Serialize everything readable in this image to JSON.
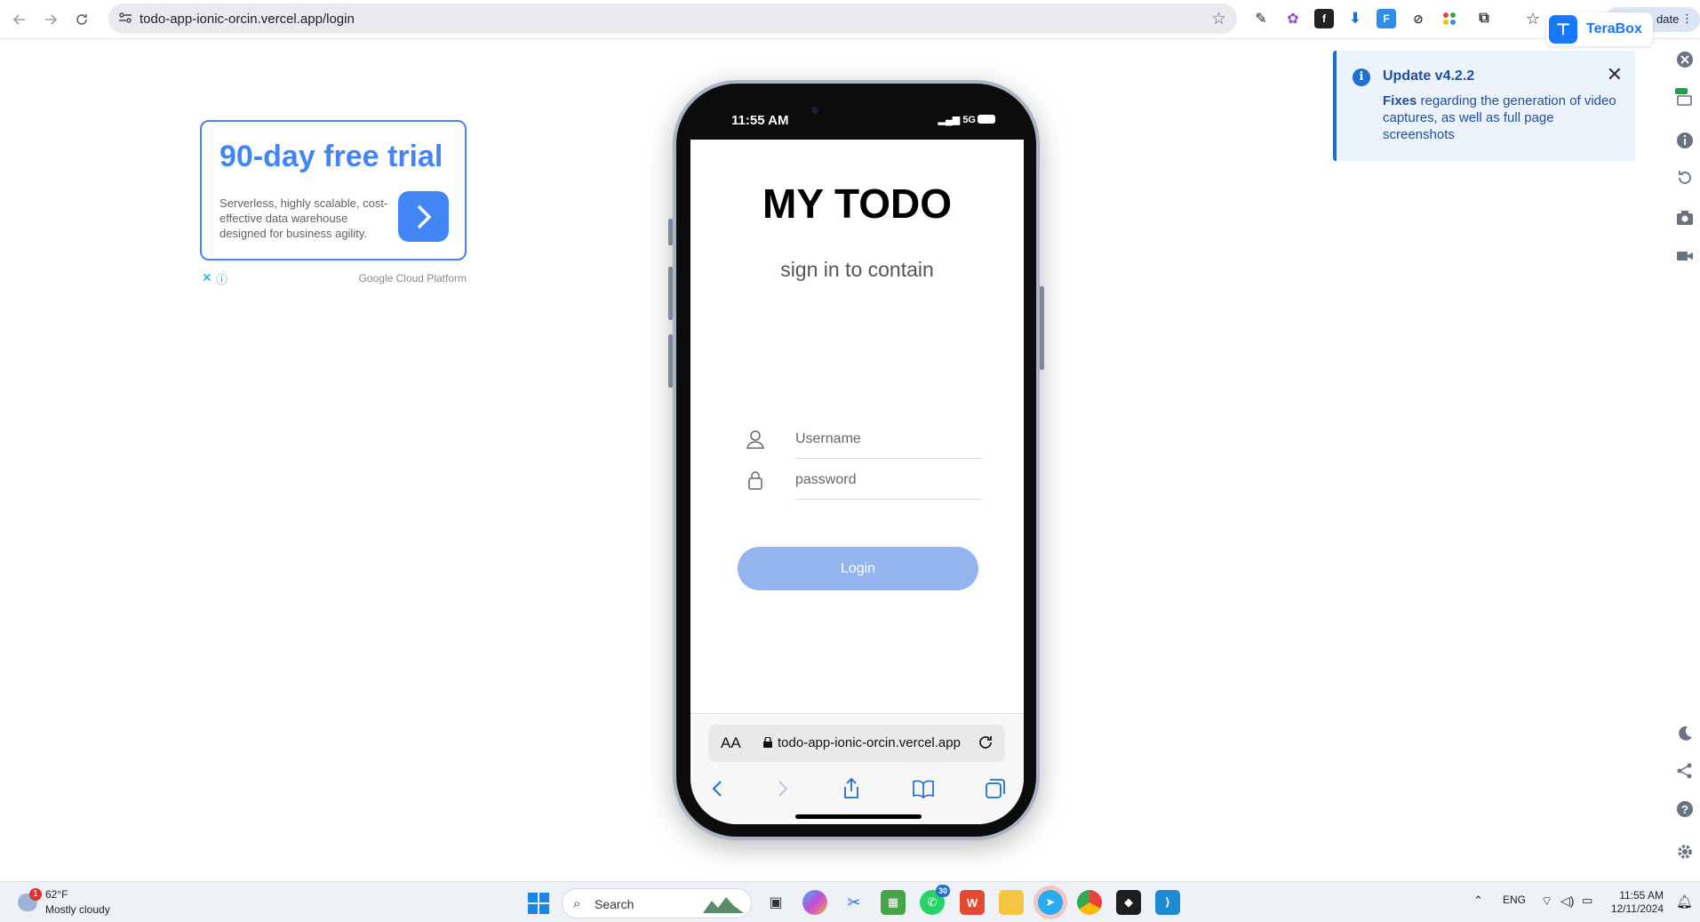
{
  "browser": {
    "url": "todo-app-ionic-orcin.vercel.app/login",
    "update_label": "date"
  },
  "terabox": {
    "label": "TeraBox"
  },
  "ad": {
    "headline": "90-day free trial",
    "description": "Serverless, highly scalable, cost-effective data warehouse designed for business agility.",
    "advertiser": "Google Cloud Platform"
  },
  "phone": {
    "status_time": "11:55 AM",
    "network": "5G",
    "app_title": "MY TODO",
    "app_subtitle": "sign in to contain",
    "username_placeholder": "Username",
    "password_placeholder": "password",
    "login_label": "Login",
    "safari": {
      "aa_label": "AA",
      "host": "todo-app-ionic-orcin.vercel.app"
    }
  },
  "toast": {
    "title": "Update v4.2.2",
    "body_strong": "Fixes",
    "body_rest": " regarding the generation of video captures, as well as full page screenshots"
  },
  "taskbar": {
    "weather_badge": "1",
    "temperature": "62°F",
    "condition": "Mostly cloudy",
    "search_label": "Search",
    "whatsapp_count": "30",
    "language": "ENG",
    "time": "11:55 AM",
    "date": "12/11/2024"
  },
  "colors": {
    "accent": "#4285f4",
    "login_button": "#92b4ef",
    "toast_accent": "#1f6fd1"
  }
}
